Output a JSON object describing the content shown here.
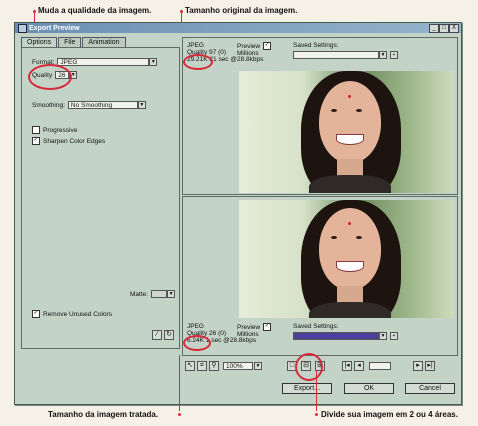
{
  "annotations": {
    "top_left": "Muda a qualidade da imagem.",
    "top_right": "Tamanho original da imagem.",
    "bottom_left": "Tamanho da imagem tratada.",
    "bottom_right": "Divide sua imagem em 2 ou 4 áreas."
  },
  "window": {
    "title": "Export Preview",
    "minimize": "_",
    "maximize": "□",
    "close": "X"
  },
  "tabs": [
    "Options",
    "File",
    "Animation"
  ],
  "options": {
    "format_label": "Format:",
    "format_value": "JPEG",
    "quality_label": "Quality",
    "quality_value": "26",
    "smoothing_label": "Smoothing:",
    "smoothing_value": "No Smoothing",
    "progressive_label": "Progressive",
    "progressive_checked": false,
    "sharpen_label": "Sharpen Color Edges",
    "sharpen_checked": true,
    "matte_label": "Matte:",
    "remove_unused_label": "Remove Unused Colors",
    "remove_unused_checked": true
  },
  "preview_top": {
    "format": "JPEG",
    "quality": "Quality 97 (0)",
    "size_info": "29.21K 21 sec @28.8kbps",
    "preview_label": "Preview",
    "colors": "Millions",
    "saved_settings_label": "Saved Settings:"
  },
  "preview_bottom": {
    "format": "JPEG",
    "quality": "Quality 26 (0)",
    "size_info": "6.24K 1 sec @28.8kbps",
    "preview_label": "Preview",
    "colors": "Millions",
    "saved_settings_label": "Saved Settings:"
  },
  "toolbar": {
    "zoom_value": "100%"
  },
  "buttons": {
    "export": "Export...",
    "ok": "OK",
    "cancel": "Cancel"
  },
  "colors": {
    "annotation": "#d62a3a",
    "window_bg": "#c4d3c8",
    "titlebar": "#6a8fb2"
  },
  "icons": [
    "pointer-icon",
    "crop-icon",
    "zoom-icon",
    "single-view-icon",
    "two-view-icon",
    "four-view-icon",
    "first-frame-icon",
    "prev-frame-icon",
    "next-frame-icon",
    "last-frame-icon"
  ]
}
